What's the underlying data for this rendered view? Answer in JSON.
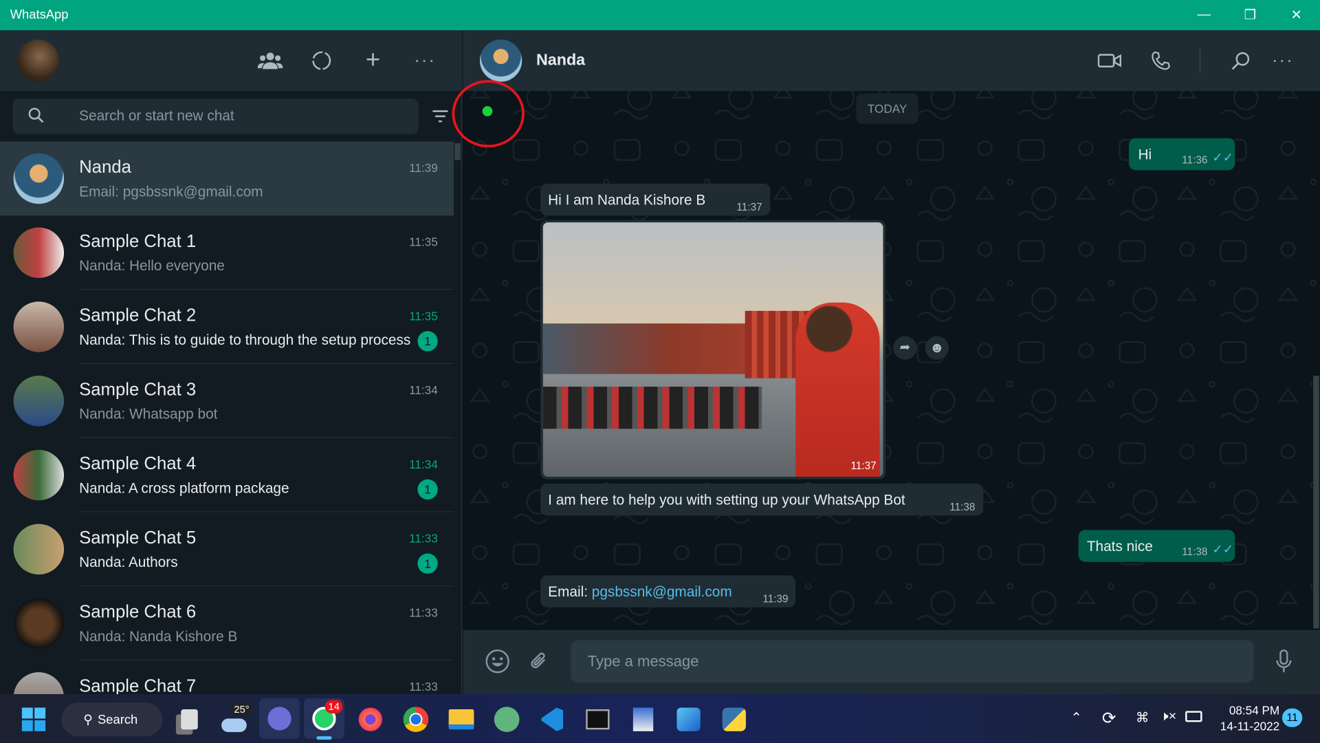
{
  "window": {
    "title": "WhatsApp"
  },
  "sidebar": {
    "search_placeholder": "Search or start new chat",
    "header_icons": [
      "community-icon",
      "status-icon",
      "new-chat-icon",
      "menu-icon"
    ],
    "chats": [
      {
        "name": "Nanda",
        "preview": "Email: pgsbssnk@gmail.com",
        "time": "11:39",
        "selected": true,
        "unread": null
      },
      {
        "name": "Sample Chat 1",
        "preview": "Nanda: Hello everyone",
        "time": "11:35",
        "unread": null
      },
      {
        "name": "Sample Chat 2",
        "preview": "Nanda: This is to guide to through the setup process",
        "time": "11:35",
        "unread": "1"
      },
      {
        "name": "Sample Chat 3",
        "preview": "Nanda: Whatsapp bot",
        "time": "11:34",
        "unread": null
      },
      {
        "name": "Sample Chat 4",
        "preview": "Nanda: A cross platform package",
        "time": "11:34",
        "unread": "1"
      },
      {
        "name": "Sample Chat 5",
        "preview": "Nanda: Authors",
        "time": "11:33",
        "unread": "1"
      },
      {
        "name": "Sample Chat 6",
        "preview": "Nanda: Nanda Kishore B",
        "time": "11:33",
        "unread": null
      },
      {
        "name": "Sample Chat 7",
        "preview": "",
        "time": "11:33",
        "unread": null
      }
    ]
  },
  "chat": {
    "contact_name": "Nanda",
    "date_label": "TODAY",
    "messages": [
      {
        "dir": "out",
        "text": "Hi",
        "time": "11:36",
        "status": "read"
      },
      {
        "dir": "in",
        "text": "Hi I am Nanda Kishore B",
        "time": "11:37"
      },
      {
        "dir": "in",
        "type": "image",
        "time": "11:37"
      },
      {
        "dir": "in",
        "text": "I am here to help you with setting up your WhatsApp Bot",
        "time": "11:38"
      },
      {
        "dir": "out",
        "text": "Thats nice",
        "time": "11:38",
        "status": "read"
      },
      {
        "dir": "in",
        "prefix": "Email: ",
        "link": "pgsbssnk@gmail.com",
        "time": "11:39"
      }
    ],
    "composer_placeholder": "Type a message"
  },
  "taskbar": {
    "search_label": "Search",
    "weather": "25°",
    "whatsapp_badge": "14",
    "clock_time": "08:54 PM",
    "clock_date": "14-11-2022",
    "notification_count": "11"
  },
  "colors": {
    "accent": "#00a884",
    "titlebar": "#00a47f",
    "outgoing": "#005c4b",
    "incoming": "#202c33",
    "link": "#53bdeb"
  }
}
